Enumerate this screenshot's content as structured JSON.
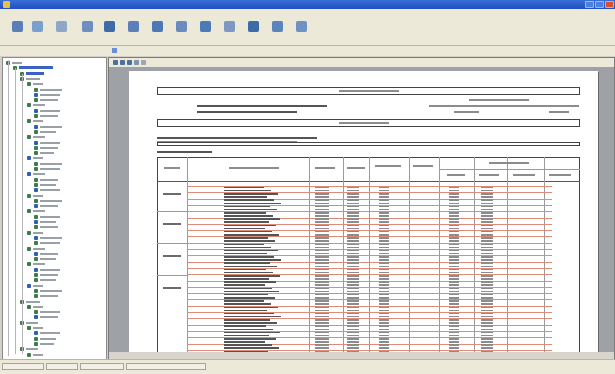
{
  "window": {
    "title": "",
    "controls": [
      "minimize",
      "maximize",
      "close"
    ]
  },
  "menubar": {
    "items": []
  },
  "toolbar": {
    "buttons": [
      {
        "icon": "print-icon",
        "color": "#5b7fb8"
      },
      {
        "icon": "open-icon",
        "color": "#7aa0cf"
      },
      {
        "icon": "back-icon",
        "color": "#8fa7c6"
      },
      {
        "icon": "export-icon",
        "color": "#6d8ec0"
      },
      {
        "icon": "report-icon",
        "color": "#3f6aa8"
      },
      {
        "icon": "table-icon",
        "color": "#5b7fb8"
      },
      {
        "icon": "chart-icon",
        "color": "#4c79b5"
      },
      {
        "icon": "filter-icon",
        "color": "#6b8bbf"
      },
      {
        "icon": "users-icon",
        "color": "#4a7bb4"
      },
      {
        "icon": "settings-icon",
        "color": "#7d98c2"
      },
      {
        "icon": "save-icon",
        "color": "#3d6ba6"
      },
      {
        "icon": "refresh-icon",
        "color": "#5a84bb"
      },
      {
        "icon": "info-icon",
        "color": "#6f92c4"
      }
    ]
  },
  "subbar": {
    "left_label": "",
    "tab_label": ""
  },
  "tree": {
    "expand_icon": "expand-icon",
    "folder_icon": "folder-icon"
  },
  "preview": {
    "toolbar_icons": [
      "first-page-icon",
      "prev-page-icon",
      "next-page-icon",
      "last-page-icon",
      "zoom-icon"
    ]
  },
  "statusbar": {
    "cells": []
  },
  "colors": {
    "accent": "#2a5bc7",
    "tree_node": "#3c7d4a",
    "row_stripe": "#e08a78"
  }
}
